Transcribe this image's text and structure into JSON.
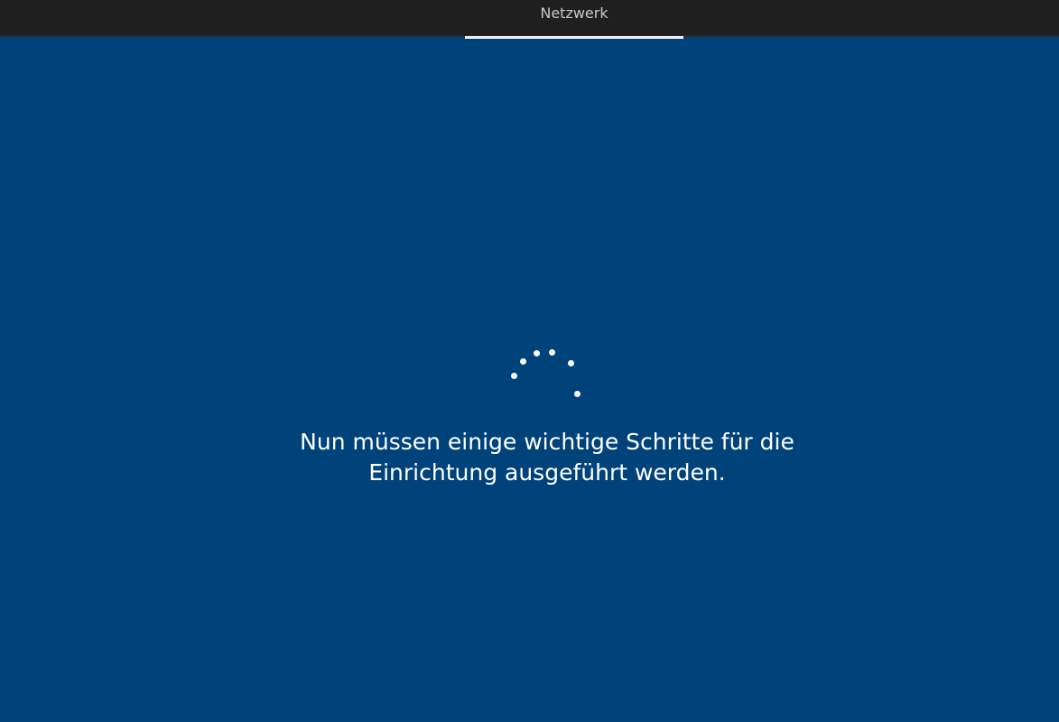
{
  "header": {
    "tab_label": "Netzwerk"
  },
  "main": {
    "message_line1": "Nun müssen einige wichtige Schritte für die",
    "message_line2": "Einrichtung ausgeführt werden."
  },
  "icons": {
    "spinner": "loading-spinner-icon"
  },
  "colors": {
    "background": "#00427a",
    "topbar": "#1f1f1f",
    "tab_text": "#c9c9c9",
    "accent": "#ffffff"
  }
}
